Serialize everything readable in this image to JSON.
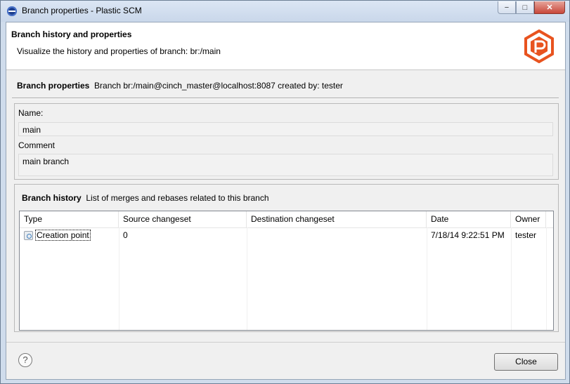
{
  "window": {
    "title": "Branch properties - Plastic SCM",
    "minimize_label": "−",
    "maximize_label": "□",
    "close_label": "✕"
  },
  "header": {
    "title": "Branch history and properties",
    "subtitle": "Visualize the history and properties of branch: br:/main",
    "logo_icon": "plastic-scm-logo-icon",
    "logo_color": "#e8531f"
  },
  "properties": {
    "label": "Branch properties",
    "value": "Branch br:/main@cinch_master@localhost:8087 created by: tester"
  },
  "name": {
    "label": "Name:",
    "value": "main"
  },
  "comment": {
    "label": "Comment",
    "value": "main branch"
  },
  "history": {
    "label": "Branch history",
    "description": "List of merges and rebases related to this branch",
    "columns": [
      "Type",
      "Source changeset",
      "Destination changeset",
      "Date",
      "Owner"
    ],
    "rows": [
      {
        "type": "Creation point",
        "source": "0",
        "destination": "",
        "date": "7/18/14 9:22:51 PM",
        "owner": "tester"
      }
    ]
  },
  "footer": {
    "help_label": "?",
    "close_label": "Close"
  }
}
